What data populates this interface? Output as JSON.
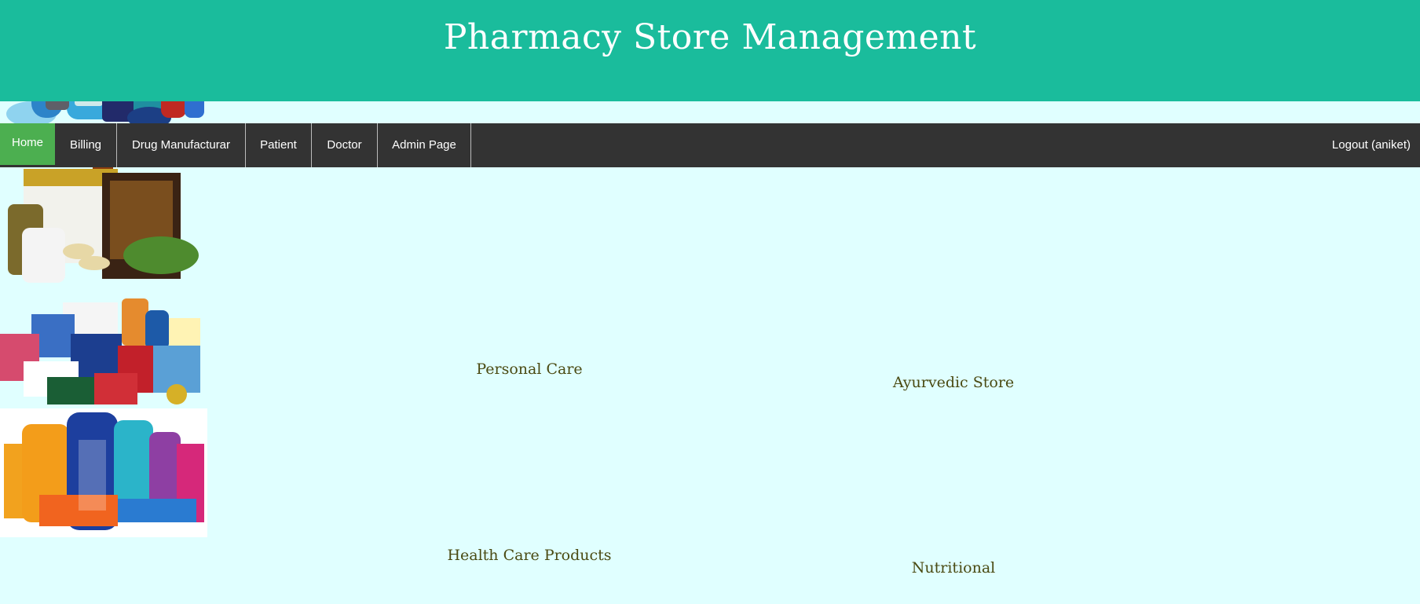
{
  "header": {
    "title": "Pharmacy Store Management"
  },
  "nav": {
    "items": [
      {
        "label": "Home",
        "active": true
      },
      {
        "label": "Billing"
      },
      {
        "label": "Drug Manufacturar"
      },
      {
        "label": "Patient"
      },
      {
        "label": "Doctor"
      },
      {
        "label": "Admin Page"
      }
    ],
    "logout_label": "Logout (aniket)"
  },
  "categories": [
    {
      "label": "Personal Care",
      "icon": "personal-care-products-image"
    },
    {
      "label": "Ayurvedic Store",
      "icon": "ayurvedic-products-image"
    },
    {
      "label": "Health Care Products",
      "icon": "health-care-products-image"
    },
    {
      "label": "Nutritional",
      "icon": "nutritional-products-image"
    }
  ],
  "colors": {
    "header_bg": "#1abc9c",
    "nav_bg": "#333333",
    "nav_active": "#4caf50",
    "page_bg": "#e0ffff",
    "label_text": "#4a4a12"
  }
}
